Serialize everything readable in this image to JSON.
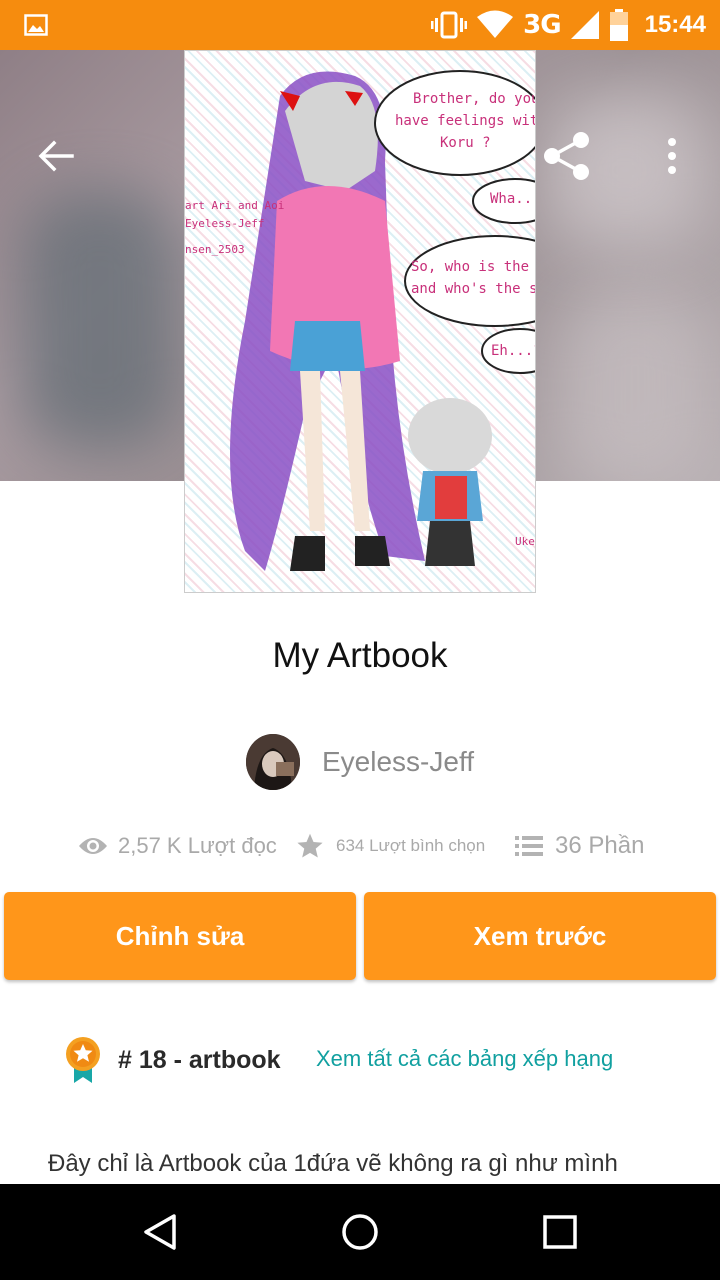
{
  "status_bar": {
    "network": "3G",
    "time": "15:44",
    "icons": [
      "gallery-icon",
      "vibrate-icon",
      "wifi-icon",
      "signal-icon",
      "battery-icon"
    ]
  },
  "header": {
    "icons": [
      "back-arrow-icon",
      "share-icon",
      "more-vert-icon"
    ]
  },
  "cover": {
    "bubbles": [
      [
        "Brother, do you",
        "have feelings with",
        "Koru ?"
      ],
      [
        "Wha...?!"
      ],
      [
        "So, who is the uke",
        "and who's the sem"
      ],
      [
        "Eh...?!"
      ]
    ],
    "side_credit": [
      "art Ari and Aoi",
      "Eyeless-Jeff",
      "nsen_2503"
    ],
    "uke_label": "Uke"
  },
  "story": {
    "title": "My Artbook",
    "author": "Eyeless-Jeff"
  },
  "stats": {
    "reads": "2,57 K Lượt đọc",
    "votes": "634 Lượt bình chọn",
    "parts": "36 Phần"
  },
  "buttons": {
    "edit": "Chỉnh sửa",
    "preview": "Xem trước"
  },
  "ranking": {
    "text": "# 18 - artbook",
    "link": "Xem tất cả các bảng xếp hạng"
  },
  "description": "Đây chỉ là Artbook của 1đứa vẽ không ra gì như mình",
  "colors": {
    "accent": "#f68c0e",
    "button": "#ff961a",
    "link": "#11a0a0",
    "stat_gray": "#a9a9a9"
  }
}
